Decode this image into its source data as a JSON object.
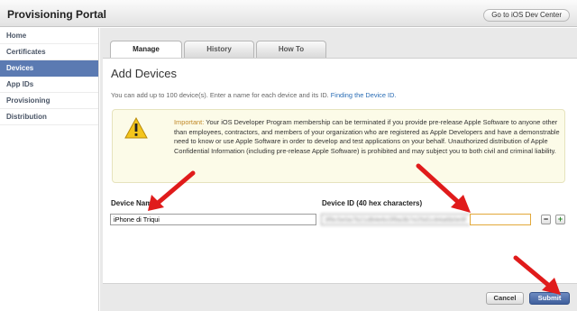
{
  "header": {
    "title": "Provisioning Portal",
    "dev_center_label": "Go to iOS Dev Center"
  },
  "sidebar": {
    "items": [
      {
        "label": "Home",
        "active": false
      },
      {
        "label": "Certificates",
        "active": false
      },
      {
        "label": "Devices",
        "active": true
      },
      {
        "label": "App IDs",
        "active": false
      },
      {
        "label": "Provisioning",
        "active": false
      },
      {
        "label": "Distribution",
        "active": false
      }
    ]
  },
  "tabs": [
    {
      "label": "Manage",
      "active": true
    },
    {
      "label": "History",
      "active": false
    },
    {
      "label": "How To",
      "active": false
    }
  ],
  "main": {
    "heading": "Add Devices",
    "intro_text": "You can add up to 100 device(s). Enter a name for each device and its ID.",
    "intro_link": "Finding the Device ID.",
    "warning": {
      "label": "Important:",
      "text": "Your iOS Developer Program membership can be terminated if you provide pre-release Apple Software to anyone other than employees, contractors, and members of your organization who are registered as Apple Developers and have a demonstrable need to know or use Apple Software in order to develop and test applications on your behalf. Unauthorized distribution of Apple Confidential Information (including pre-release Apple Software) is prohibited and may subject you to both civil and criminal liability."
    },
    "columns": {
      "device_name": "Device Name",
      "device_id": "Device ID (40 hex characters)"
    },
    "row": {
      "device_name_value": "iPhone di Triqui",
      "device_id_value": "3f9c5e0a7b21d84e6c0f9a3b7e25d1c84a6b0e9f"
    },
    "buttons": {
      "remove": "−",
      "add": "+",
      "cancel": "Cancel",
      "submit": "Submit"
    }
  },
  "colors": {
    "accent": "#5b7ab2",
    "annotation_arrow": "#e01b1b",
    "warning_bg": "#fcfbe8"
  }
}
